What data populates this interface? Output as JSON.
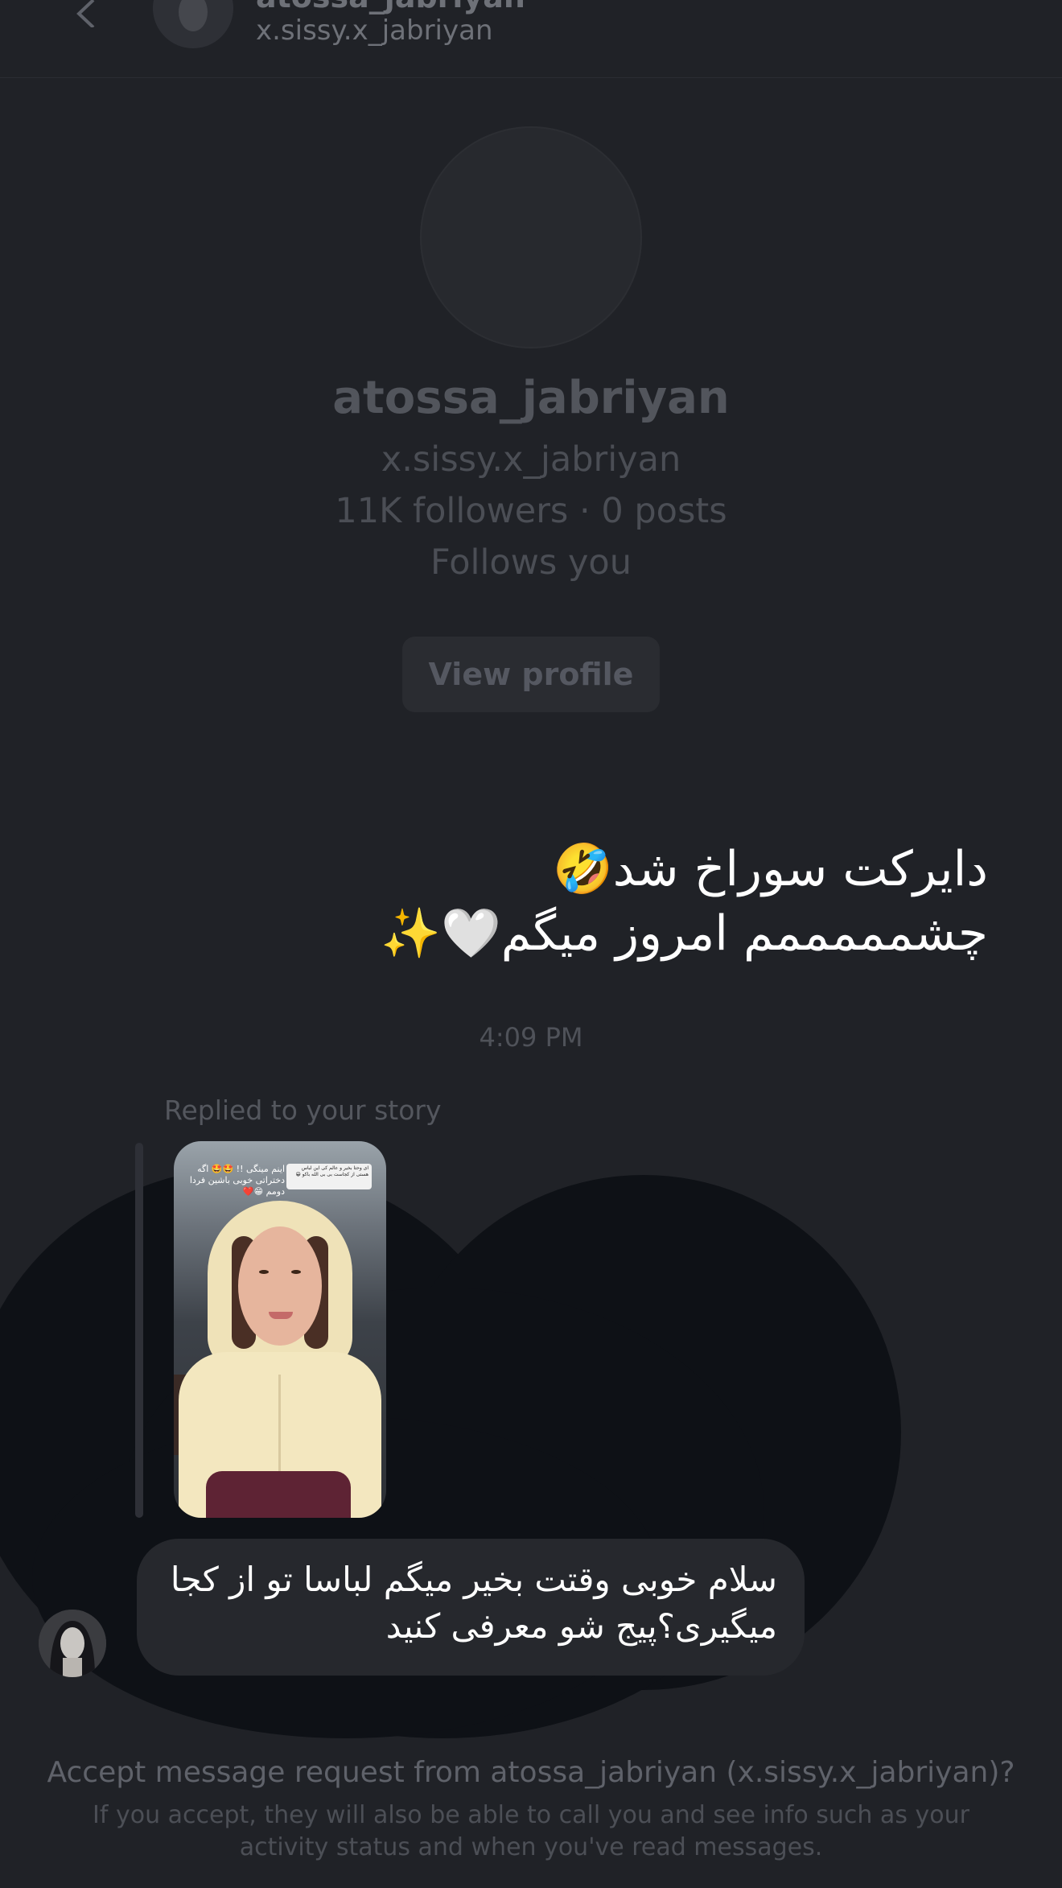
{
  "header": {
    "name": "atossa_jabriyan",
    "username": "x.sissy.x_jabriyan"
  },
  "profile": {
    "name": "atossa_jabriyan",
    "username": "x.sissy.x_jabriyan",
    "stats": "11K followers · 0 posts",
    "relation": "Follows you",
    "view_profile_label": "View profile"
  },
  "thread": {
    "sent_message": "دایرکت سوراخ شد🤣\nچشمممممم امروز میگم🤍✨",
    "timestamp": "4:09 PM",
    "replied_label": "Replied to your story",
    "story_overlay_text": "اینم مینگی !! 🤩🤩 اگه دختراتی خوبی باشین فردا دومم 😁❤️",
    "story_question_text": "ای وحتا بخیر و عالم کی این لباس هستی از کجاست بی بی الله باکو 😁",
    "received_message": "سلام خوبی وقتت بخیر میگم لباسا تو از کجا میگیری؟پیج شو معرفی کنید"
  },
  "request": {
    "title": "Accept message request from atossa_jabriyan (x.sissy.x_jabriyan)?",
    "body": "If you accept, they will also be able to call you and see info such as your activity status and when you've read messages."
  },
  "colors": {
    "background": "#202227",
    "bubble": "#26282d",
    "redaction": "#0e1116"
  }
}
